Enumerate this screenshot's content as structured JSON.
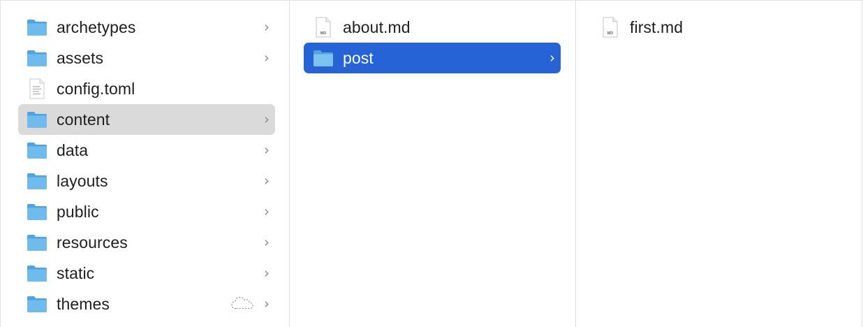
{
  "columns": [
    {
      "items": [
        {
          "label": "archetypes",
          "icon": "folder-icon",
          "has_children": true
        },
        {
          "label": "assets",
          "icon": "folder-icon",
          "has_children": true
        },
        {
          "label": "config.toml",
          "icon": "text-file-icon",
          "has_children": false
        },
        {
          "label": "content",
          "icon": "folder-icon",
          "has_children": true,
          "selected": "inactive"
        },
        {
          "label": "data",
          "icon": "folder-icon",
          "has_children": true
        },
        {
          "label": "layouts",
          "icon": "folder-icon",
          "has_children": true
        },
        {
          "label": "public",
          "icon": "folder-icon",
          "has_children": true
        },
        {
          "label": "resources",
          "icon": "folder-icon",
          "has_children": true
        },
        {
          "label": "static",
          "icon": "folder-icon",
          "has_children": true
        },
        {
          "label": "themes",
          "icon": "folder-icon",
          "has_children": true,
          "status": "icloud-not-downloaded-icon"
        }
      ]
    },
    {
      "items": [
        {
          "label": "about.md",
          "icon": "md-file-icon",
          "badge": "MD",
          "has_children": false
        },
        {
          "label": "post",
          "icon": "folder-icon",
          "has_children": true,
          "selected": "active"
        }
      ]
    },
    {
      "items": [
        {
          "label": "first.md",
          "icon": "md-file-icon",
          "badge": "MD",
          "has_children": false
        }
      ]
    }
  ],
  "chevron_glyph": "›",
  "colors": {
    "selection_active": "#2563d6",
    "selection_inactive": "#dadada",
    "folder_front": "#6fbbee",
    "folder_back": "#4fa3e0"
  }
}
